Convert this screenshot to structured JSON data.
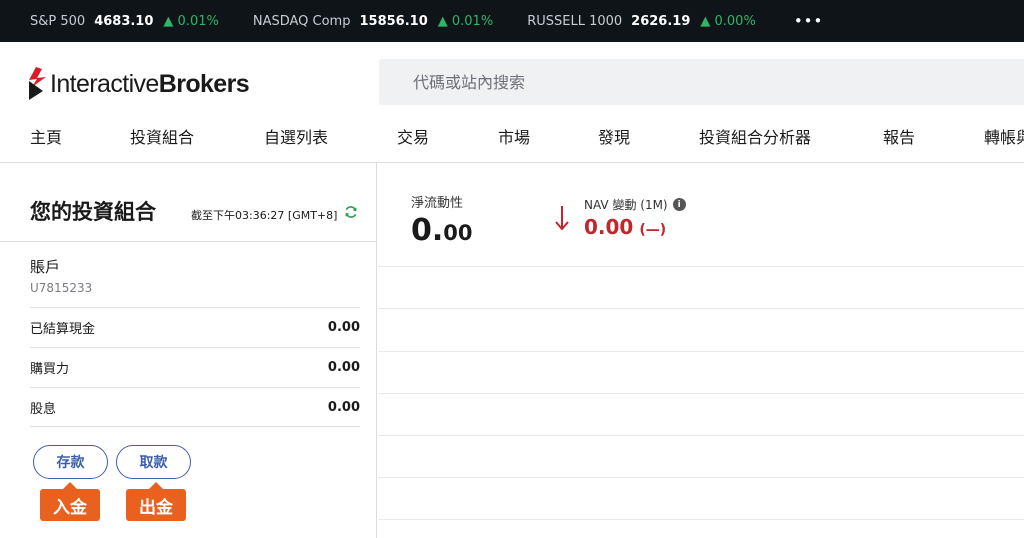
{
  "ticker": {
    "items": [
      {
        "name": "S&P 500",
        "value": "4683.10",
        "change": "▲ 0.01%"
      },
      {
        "name": "NASDAQ Comp",
        "value": "15856.10",
        "change": "▲ 0.01%"
      },
      {
        "name": "RUSSELL 1000",
        "value": "2626.19",
        "change": "▲ 0.00%"
      }
    ],
    "more": "•••",
    "up_color": "#2fb568"
  },
  "brand": {
    "name_part1": "Interactive",
    "name_part2": "Brokers",
    "logo_color": "#d81e2a"
  },
  "search": {
    "placeholder": "代碼或站內搜索",
    "value": ""
  },
  "nav": {
    "items": [
      "主頁",
      "投資組合",
      "自選列表",
      "交易",
      "市場",
      "發現",
      "投資組合分析器",
      "報告",
      "轉帳與支付"
    ]
  },
  "portfolio": {
    "title": "您的投資組合",
    "as_of": "截至下午03:36:27 [GMT+8]",
    "account_label": "賬戶",
    "account_id": "U7815233",
    "rows": [
      {
        "label": "已結算現金",
        "value": "0.00"
      },
      {
        "label": "購買力",
        "value": "0.00"
      },
      {
        "label": "股息",
        "value": "0.00"
      }
    ],
    "deposit_label": "存款",
    "withdraw_label": "取款",
    "deposit_tag": "入金",
    "withdraw_tag": "出金",
    "accent_color": "#3e5fae",
    "tag_color": "#e8611f"
  },
  "summary": {
    "net_liq_label": "淨流動性",
    "net_liq_int": "0.",
    "net_liq_dec": "00",
    "nav_change_label": "NAV 變動 (1M)",
    "nav_change_value": "0.00",
    "nav_change_pct": "(—)",
    "negative_color": "#c0272d"
  }
}
